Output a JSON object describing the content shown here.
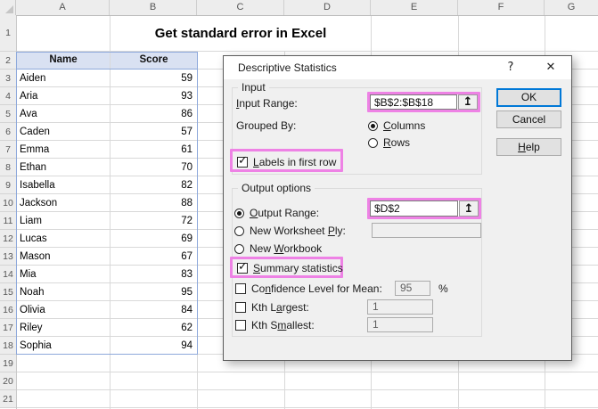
{
  "sheet": {
    "columns": [
      "A",
      "B",
      "C",
      "D",
      "E",
      "F",
      "G"
    ],
    "row_numbers": [
      "1",
      "2",
      "3",
      "4",
      "5",
      "6",
      "7",
      "8",
      "9",
      "10",
      "11",
      "12",
      "13",
      "14",
      "15",
      "16",
      "17",
      "18",
      "19",
      "20",
      "21"
    ],
    "title": "Get standard error in Excel",
    "table": {
      "headers": {
        "name": "Name",
        "score": "Score"
      },
      "rows": [
        {
          "name": "Aiden",
          "score": 59
        },
        {
          "name": "Aria",
          "score": 93
        },
        {
          "name": "Ava",
          "score": 86
        },
        {
          "name": "Caden",
          "score": 57
        },
        {
          "name": "Emma",
          "score": 61
        },
        {
          "name": "Ethan",
          "score": 70
        },
        {
          "name": "Isabella",
          "score": 82
        },
        {
          "name": "Jackson",
          "score": 88
        },
        {
          "name": "Liam",
          "score": 72
        },
        {
          "name": "Lucas",
          "score": 69
        },
        {
          "name": "Mason",
          "score": 67
        },
        {
          "name": "Mia",
          "score": 83
        },
        {
          "name": "Noah",
          "score": 95
        },
        {
          "name": "Olivia",
          "score": 84
        },
        {
          "name": "Riley",
          "score": 62
        },
        {
          "name": "Sophia",
          "score": 94
        }
      ]
    }
  },
  "dialog": {
    "title": "Descriptive Statistics",
    "glyphs": {
      "help": "?",
      "close": "✕",
      "check": "✓",
      "picker": "↥"
    },
    "groups": {
      "input": "Input",
      "output": "Output options"
    },
    "fields": {
      "input_range": {
        "label_u": "I",
        "label_post": "nput Range:",
        "value": "$B$2:$B$18"
      },
      "grouped_by": {
        "label": "Grouped By:"
      },
      "columns": {
        "label_u": "C",
        "label_post": "olumns"
      },
      "rows": {
        "label_u": "R",
        "label_post": "ows"
      },
      "labels_first_row": {
        "label_u": "L",
        "label_post": "abels in first row"
      },
      "output_range": {
        "label_u": "O",
        "label_post": "utput Range:",
        "value": "$D$2"
      },
      "new_worksheet_ply": {
        "label_pre": "New Worksheet ",
        "label_u": "P",
        "label_post": "ly:",
        "value": ""
      },
      "new_workbook": {
        "label_pre": "New ",
        "label_u": "W",
        "label_post": "orkbook"
      },
      "summary_statistics": {
        "label_u": "S",
        "label_post": "ummary statistics"
      },
      "confidence_level": {
        "label_pre": "Co",
        "label_u": "n",
        "label_post": "fidence Level for Mean:",
        "value": "95",
        "suffix": "%"
      },
      "kth_largest": {
        "label_pre": "Kth L",
        "label_u": "a",
        "label_post": "rgest:",
        "value": "1"
      },
      "kth_smallest": {
        "label_pre": "Kth S",
        "label_u": "m",
        "label_post": "allest:",
        "value": "1"
      }
    },
    "state": {
      "grouped_by_selected": "Columns",
      "output_destination_selected": "Output Range",
      "labels_in_first_row_checked": true,
      "summary_statistics_checked": true,
      "confidence_level_checked": false,
      "kth_largest_checked": false,
      "kth_smallest_checked": false
    },
    "buttons": {
      "ok": "OK",
      "cancel": "Cancel",
      "help_u": "H",
      "help_post": "elp"
    }
  },
  "colors": {
    "annotation_pink": "#EE82E5",
    "table_header_fill": "#D9E1F2",
    "table_border": "#8EA9DB",
    "ok_default_border": "#0078D7",
    "dialog_background": "#F0F0F0"
  }
}
